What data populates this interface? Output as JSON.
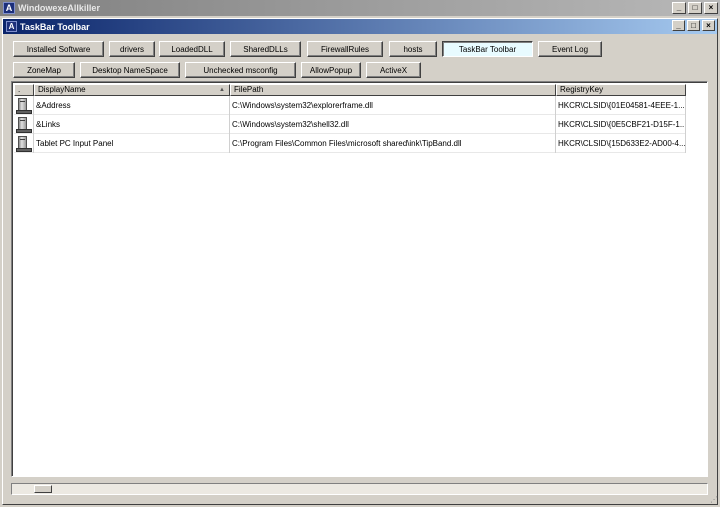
{
  "app": {
    "title": "WindowexeAllkiller",
    "icon_letter": "A",
    "controls": [
      "_",
      "□",
      "×"
    ]
  },
  "inner_window": {
    "title": "TaskBar Toolbar",
    "icon_letter": "A",
    "controls": [
      "_",
      "□",
      "×"
    ]
  },
  "toolbar_row1": [
    {
      "label": "Installed Software",
      "active": false
    },
    {
      "label": "drivers",
      "active": false
    },
    {
      "label": "LoadedDLL",
      "active": false
    },
    {
      "label": "SharedDLLs",
      "active": false
    },
    {
      "label": "FirewallRules",
      "active": false
    },
    {
      "label": "hosts",
      "active": false
    },
    {
      "label": "TaskBar Toolbar",
      "active": true
    },
    {
      "label": "Event Log",
      "active": false
    }
  ],
  "toolbar_row2": [
    {
      "label": "ZoneMap",
      "active": false
    },
    {
      "label": "Desktop NameSpace",
      "active": false
    },
    {
      "label": "Unchecked msconfig",
      "active": false
    },
    {
      "label": "AllowPopup",
      "active": false
    },
    {
      "label": "ActiveX",
      "active": false
    }
  ],
  "table": {
    "columns": [
      ".",
      "DisplayName",
      "FilePath",
      "RegistryKey"
    ],
    "sorted_column": "DisplayName",
    "sort_indicator": "▲",
    "rows": [
      {
        "icon": "computer-icon",
        "name": "&Address",
        "path": "C:\\Windows\\system32\\explorerframe.dll",
        "key": "HKCR\\CLSID\\{01E04581-4EEE-1..."
      },
      {
        "icon": "computer-icon",
        "name": "&Links",
        "path": "C:\\Windows\\system32\\shell32.dll",
        "key": "HKCR\\CLSID\\{0E5CBF21-D15F-1..."
      },
      {
        "icon": "computer-icon",
        "name": "Tablet PC Input Panel",
        "path": "C:\\Program Files\\Common Files\\microsoft shared\\ink\\TipBand.dll",
        "key": "HKCR\\CLSID\\{15D633E2-AD00-4..."
      }
    ]
  },
  "statusbar": {
    "grip": "⋰"
  }
}
